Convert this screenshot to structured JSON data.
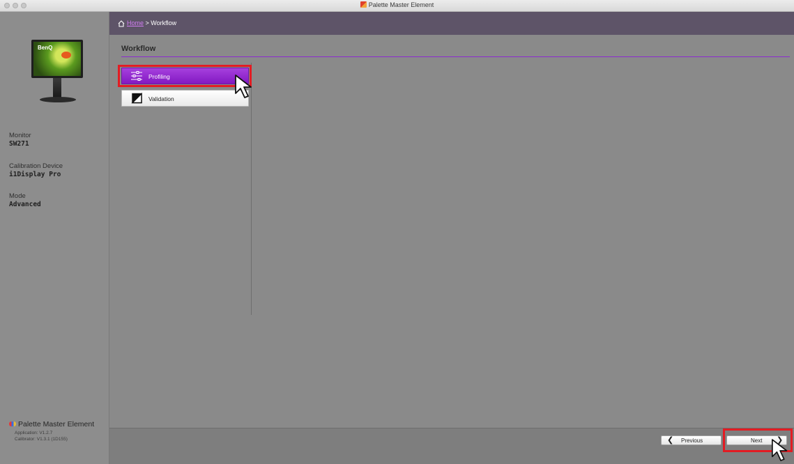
{
  "window": {
    "title": "Palette Master Element"
  },
  "breadcrumb": {
    "home": "Home",
    "separator": " > ",
    "current": "Workflow"
  },
  "sidebar": {
    "monitor_brand": "BenQ",
    "monitor_label": "Monitor",
    "monitor_value": "SW271",
    "device_label": "Calibration Device",
    "device_value": "i1Display Pro",
    "mode_label": "Mode",
    "mode_value": "Advanced",
    "app_name": "Palette Master Element",
    "app_version": "Application: V1.2.7",
    "calibrator_version": "Calibrator: V1.3.1 (1D155)"
  },
  "workflow": {
    "title": "Workflow",
    "items": [
      {
        "label": "Profiling",
        "icon": "sliders-icon",
        "selected": true
      },
      {
        "label": "Validation",
        "icon": "contrast-icon",
        "selected": false
      }
    ]
  },
  "footer": {
    "previous_label": "Previous",
    "next_label": "Next"
  },
  "colors": {
    "accent": "#8b2ad0",
    "highlight": "#e31c23",
    "breadcrumb_bg": "#5e5468"
  }
}
